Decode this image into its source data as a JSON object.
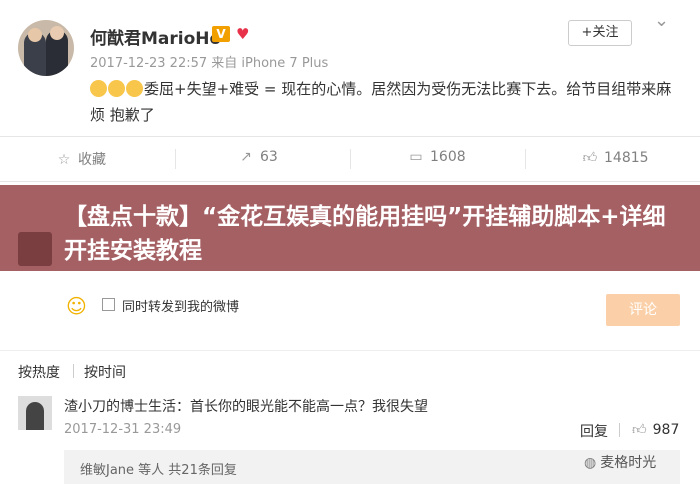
{
  "post": {
    "username": "何猷君MarioHo",
    "verified_badge": "V",
    "meta": "2017-12-23 22:57 来自 iPhone 7 Plus",
    "follow_label": "+关注",
    "content": "委屈+失望+难受 = 现在的心情。居然因为受伤无法比赛下去。给节目组带来麻烦 抱歉了",
    "emoji_icons": [
      "grimace-emoji",
      "grimace-emoji",
      "grimace-emoji"
    ]
  },
  "actions": {
    "favorite_label": "收藏",
    "share_count": "63",
    "comment_count": "1608",
    "like_count": "14815"
  },
  "banner": {
    "title": "【盘点十款】“金花互娱真的能用挂吗”开挂辅助脚本+详细开挂安装教程",
    "color": "#96464b"
  },
  "comment_box": {
    "also_post_label": "同时转发到我的微博",
    "submit_label": "评论"
  },
  "sort": {
    "hot_label": "按热度",
    "time_label": "按时间"
  },
  "comment": {
    "author_and_text": "渣小刀的博士生活：首长你的眼光能不能高一点？我很失望",
    "time": "2017-12-31 23:49",
    "reply_label": "回复",
    "like_count": "987",
    "sub_replies": "维敏Jane 等人 共21条回复"
  },
  "watermark": {
    "text": "麦格时光"
  }
}
